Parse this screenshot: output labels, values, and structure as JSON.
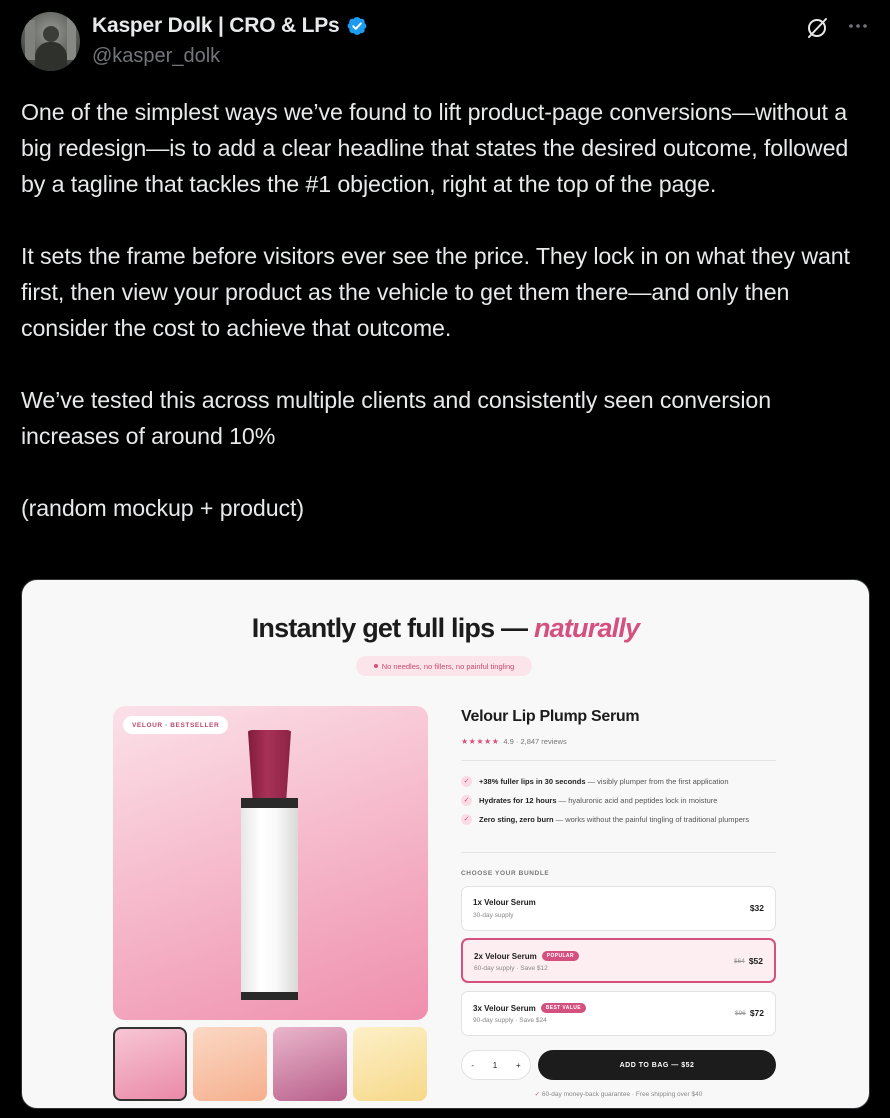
{
  "tweet": {
    "author_name": "Kasper Dolk | CRO & LPs",
    "handle": "@kasper_dolk",
    "verified_icon": "verified-badge-icon",
    "paragraphs": [
      "One of the simplest ways we’ve found to lift product-page conversions—without a big redesign—is to add a clear headline that states the desired outcome, followed by a tagline that tackles the #1 objection, right at the top of the page.",
      "It sets the frame before visitors ever see the price. They lock in on what they want first, then view your product as the vehicle to get them there—and only then consider the cost to achieve that outcome.",
      "We’ve tested this across multiple clients and consistently seen conversion increases of around 10%",
      "(random mockup + product)"
    ]
  },
  "mockup": {
    "headline_main": "Instantly get full lips — ",
    "headline_accent": "naturally",
    "tagline": "No needles, no fillers, no painful tingling",
    "hero_badge": "VELOUR · BESTSELLER",
    "product_title": "Velour Lip Plump Serum",
    "stars": "★★★★★",
    "reviews": "4.9 · 2,847 reviews",
    "benefits": [
      {
        "bold": "+38% fuller lips in 30 seconds",
        "rest": " — visibly plumper from the first application"
      },
      {
        "bold": "Hydrates for 12 hours",
        "rest": " — hyaluronic acid and peptides lock in moisture"
      },
      {
        "bold": "Zero sting, zero burn",
        "rest": " — works without the painful tingling of traditional plumpers"
      }
    ],
    "bundle_heading": "CHOOSE YOUR BUNDLE",
    "bundles": [
      {
        "name": "1x Velour Serum",
        "sub": "30-day supply",
        "old_price": "",
        "price": "$32",
        "tag": ""
      },
      {
        "name": "2x Velour Serum",
        "sub": "60-day supply · Save $12",
        "old_price": "$64",
        "price": "$52",
        "tag": "POPULAR"
      },
      {
        "name": "3x Velour Serum",
        "sub": "90-day supply · Save $24",
        "old_price": "$96",
        "price": "$72",
        "tag": "BEST VALUE"
      }
    ],
    "qty_minus": "-",
    "qty_value": "1",
    "qty_plus": "+",
    "add_to_bag": "ADD TO BAG — $52",
    "guarantee": "60-day money-back guarantee · Free shipping over $40",
    "accent_color": "#d4507e"
  }
}
